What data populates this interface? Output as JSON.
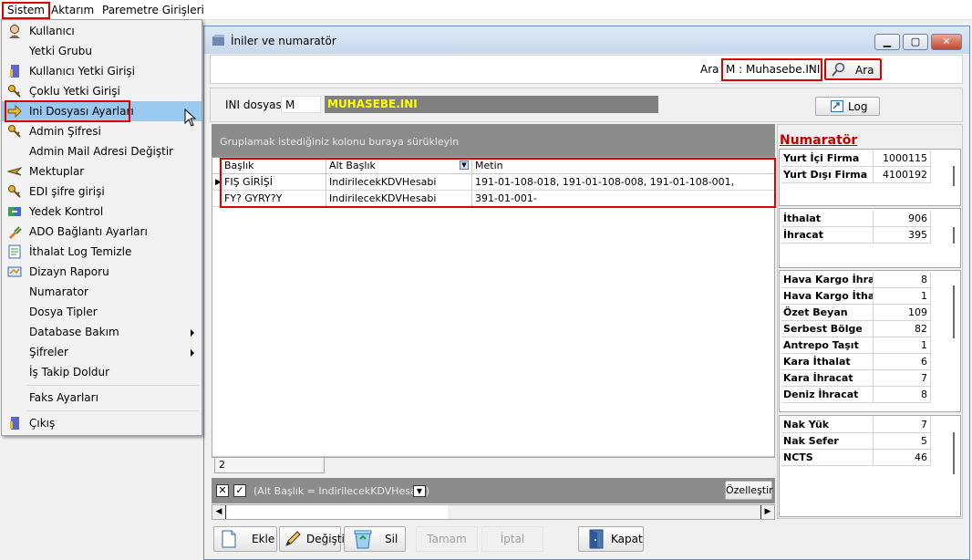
{
  "menubar": {
    "items": [
      "Sistem",
      "Aktarım",
      "Paremetre Girişleri"
    ]
  },
  "menu": {
    "items": [
      {
        "label": "Kullanıcı",
        "icon": "user-icon"
      },
      {
        "label": "Yetki Grubu",
        "icon": ""
      },
      {
        "label": "Kullanıcı Yetki Girişi",
        "icon": "door-icon"
      },
      {
        "label": "Çoklu Yetki Girişi",
        "icon": "keys-icon"
      },
      {
        "label": "Ini Dosyası  Ayarları",
        "icon": "arrow-icon"
      },
      {
        "label": "Admin Şifresi",
        "icon": "key-icon"
      },
      {
        "label": "Admin Mail Adresi Değiştir",
        "icon": ""
      },
      {
        "label": "Mektuplar",
        "icon": "plane-icon"
      },
      {
        "label": "EDI şifre girişi",
        "icon": "keys-icon"
      },
      {
        "label": "Yedek Kontrol",
        "icon": "backup-icon"
      },
      {
        "label": "ADO Bağlantı Ayarları",
        "icon": "plug-icon"
      },
      {
        "label": "İthalat Log Temizle",
        "icon": "log-icon"
      },
      {
        "label": "Dizayn Raporu",
        "icon": "report-icon"
      },
      {
        "label": "Numarator",
        "icon": ""
      },
      {
        "label": "Dosya Tipler",
        "icon": ""
      },
      {
        "label": "Database Bakım",
        "icon": ""
      },
      {
        "label": "Şifreler",
        "icon": ""
      },
      {
        "label": "İş Takip Doldur",
        "icon": ""
      },
      {
        "label": "Faks Ayarları",
        "icon": ""
      },
      {
        "label": "Çıkış",
        "icon": "exit-icon"
      }
    ]
  },
  "window": {
    "title": "İniler ve numaratör",
    "search_label": "Ara",
    "search_value": "M : Muhasebe.INI",
    "search_button": "Ara",
    "ini_label": "INI dosyası",
    "ini_code": "M",
    "ini_name": "MUHASEBE.INI",
    "log_button": "Log"
  },
  "grid": {
    "group_hint": "Gruplamak istediğiniz kolonu buraya sürükleyin",
    "columns": [
      "Başlık",
      "Alt Başlık",
      "Metin"
    ],
    "rows": [
      [
        "FIŞ GİRİŞİ",
        "IndirilecekKDVHesabi",
        "191-01-108-018, 191-01-108-008, 191-01-108-001,"
      ],
      [
        "FY? GYRY?Y",
        "IndirilecekKDVHesabi",
        "391-01-001-"
      ]
    ],
    "count": "2",
    "filter_text": "(Alt Başlık = IndirilecekKDVHesabi)",
    "customize_button": "Özelleştir"
  },
  "numarator": {
    "title": "Numaratör",
    "group1": [
      [
        "Yurt İçi Firma",
        "1000115"
      ],
      [
        "Yurt Dışı Firma",
        "4100192"
      ]
    ],
    "group2": [
      [
        "İthalat",
        "906"
      ],
      [
        "İhracat",
        "395"
      ]
    ],
    "group3": [
      [
        "Hava Kargo İhrac",
        "8"
      ],
      [
        "Hava Kargo İthal",
        "1"
      ],
      [
        "Özet Beyan",
        "109"
      ],
      [
        "Serbest Bölge",
        "82"
      ],
      [
        "Antrepo Taşıt",
        "1"
      ],
      [
        "Kara İthalat",
        "6"
      ],
      [
        "Kara İhracat",
        "7"
      ],
      [
        "Deniz İhracat",
        "8"
      ]
    ],
    "group4": [
      [
        "Nak Yük",
        "7"
      ],
      [
        "Nak Sefer",
        "5"
      ],
      [
        "NCTS",
        "46"
      ]
    ]
  },
  "toolbar": {
    "add": "Ekle",
    "edit": "Değiştir",
    "delete": "Sil",
    "ok": "Tamam",
    "cancel": "İptal",
    "close": "Kapat"
  },
  "colors": {
    "highlight": "#e00000",
    "menu_selected": "#99c9ef",
    "ini_name_bg": "#808080",
    "ini_name_fg": "#ffff00",
    "numarator_title": "#c00000",
    "group_panel": "#8c8c8c"
  }
}
